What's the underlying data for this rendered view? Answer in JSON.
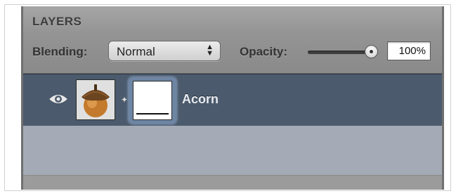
{
  "panel": {
    "title": "LAYERS",
    "blending_label": "Blending:",
    "blending_value": "Normal",
    "opacity_label": "Opacity:",
    "opacity_value": "100%",
    "opacity_fraction": 1.0
  },
  "layers": [
    {
      "name": "Acorn",
      "visible": true,
      "selected": true,
      "thumbnail_icon": "acorn-icon",
      "has_mask": true
    }
  ],
  "colors": {
    "selected_row": "#4b5a6c",
    "panel_bg": "#8f8f8f",
    "empty_area": "#a4abb6"
  }
}
